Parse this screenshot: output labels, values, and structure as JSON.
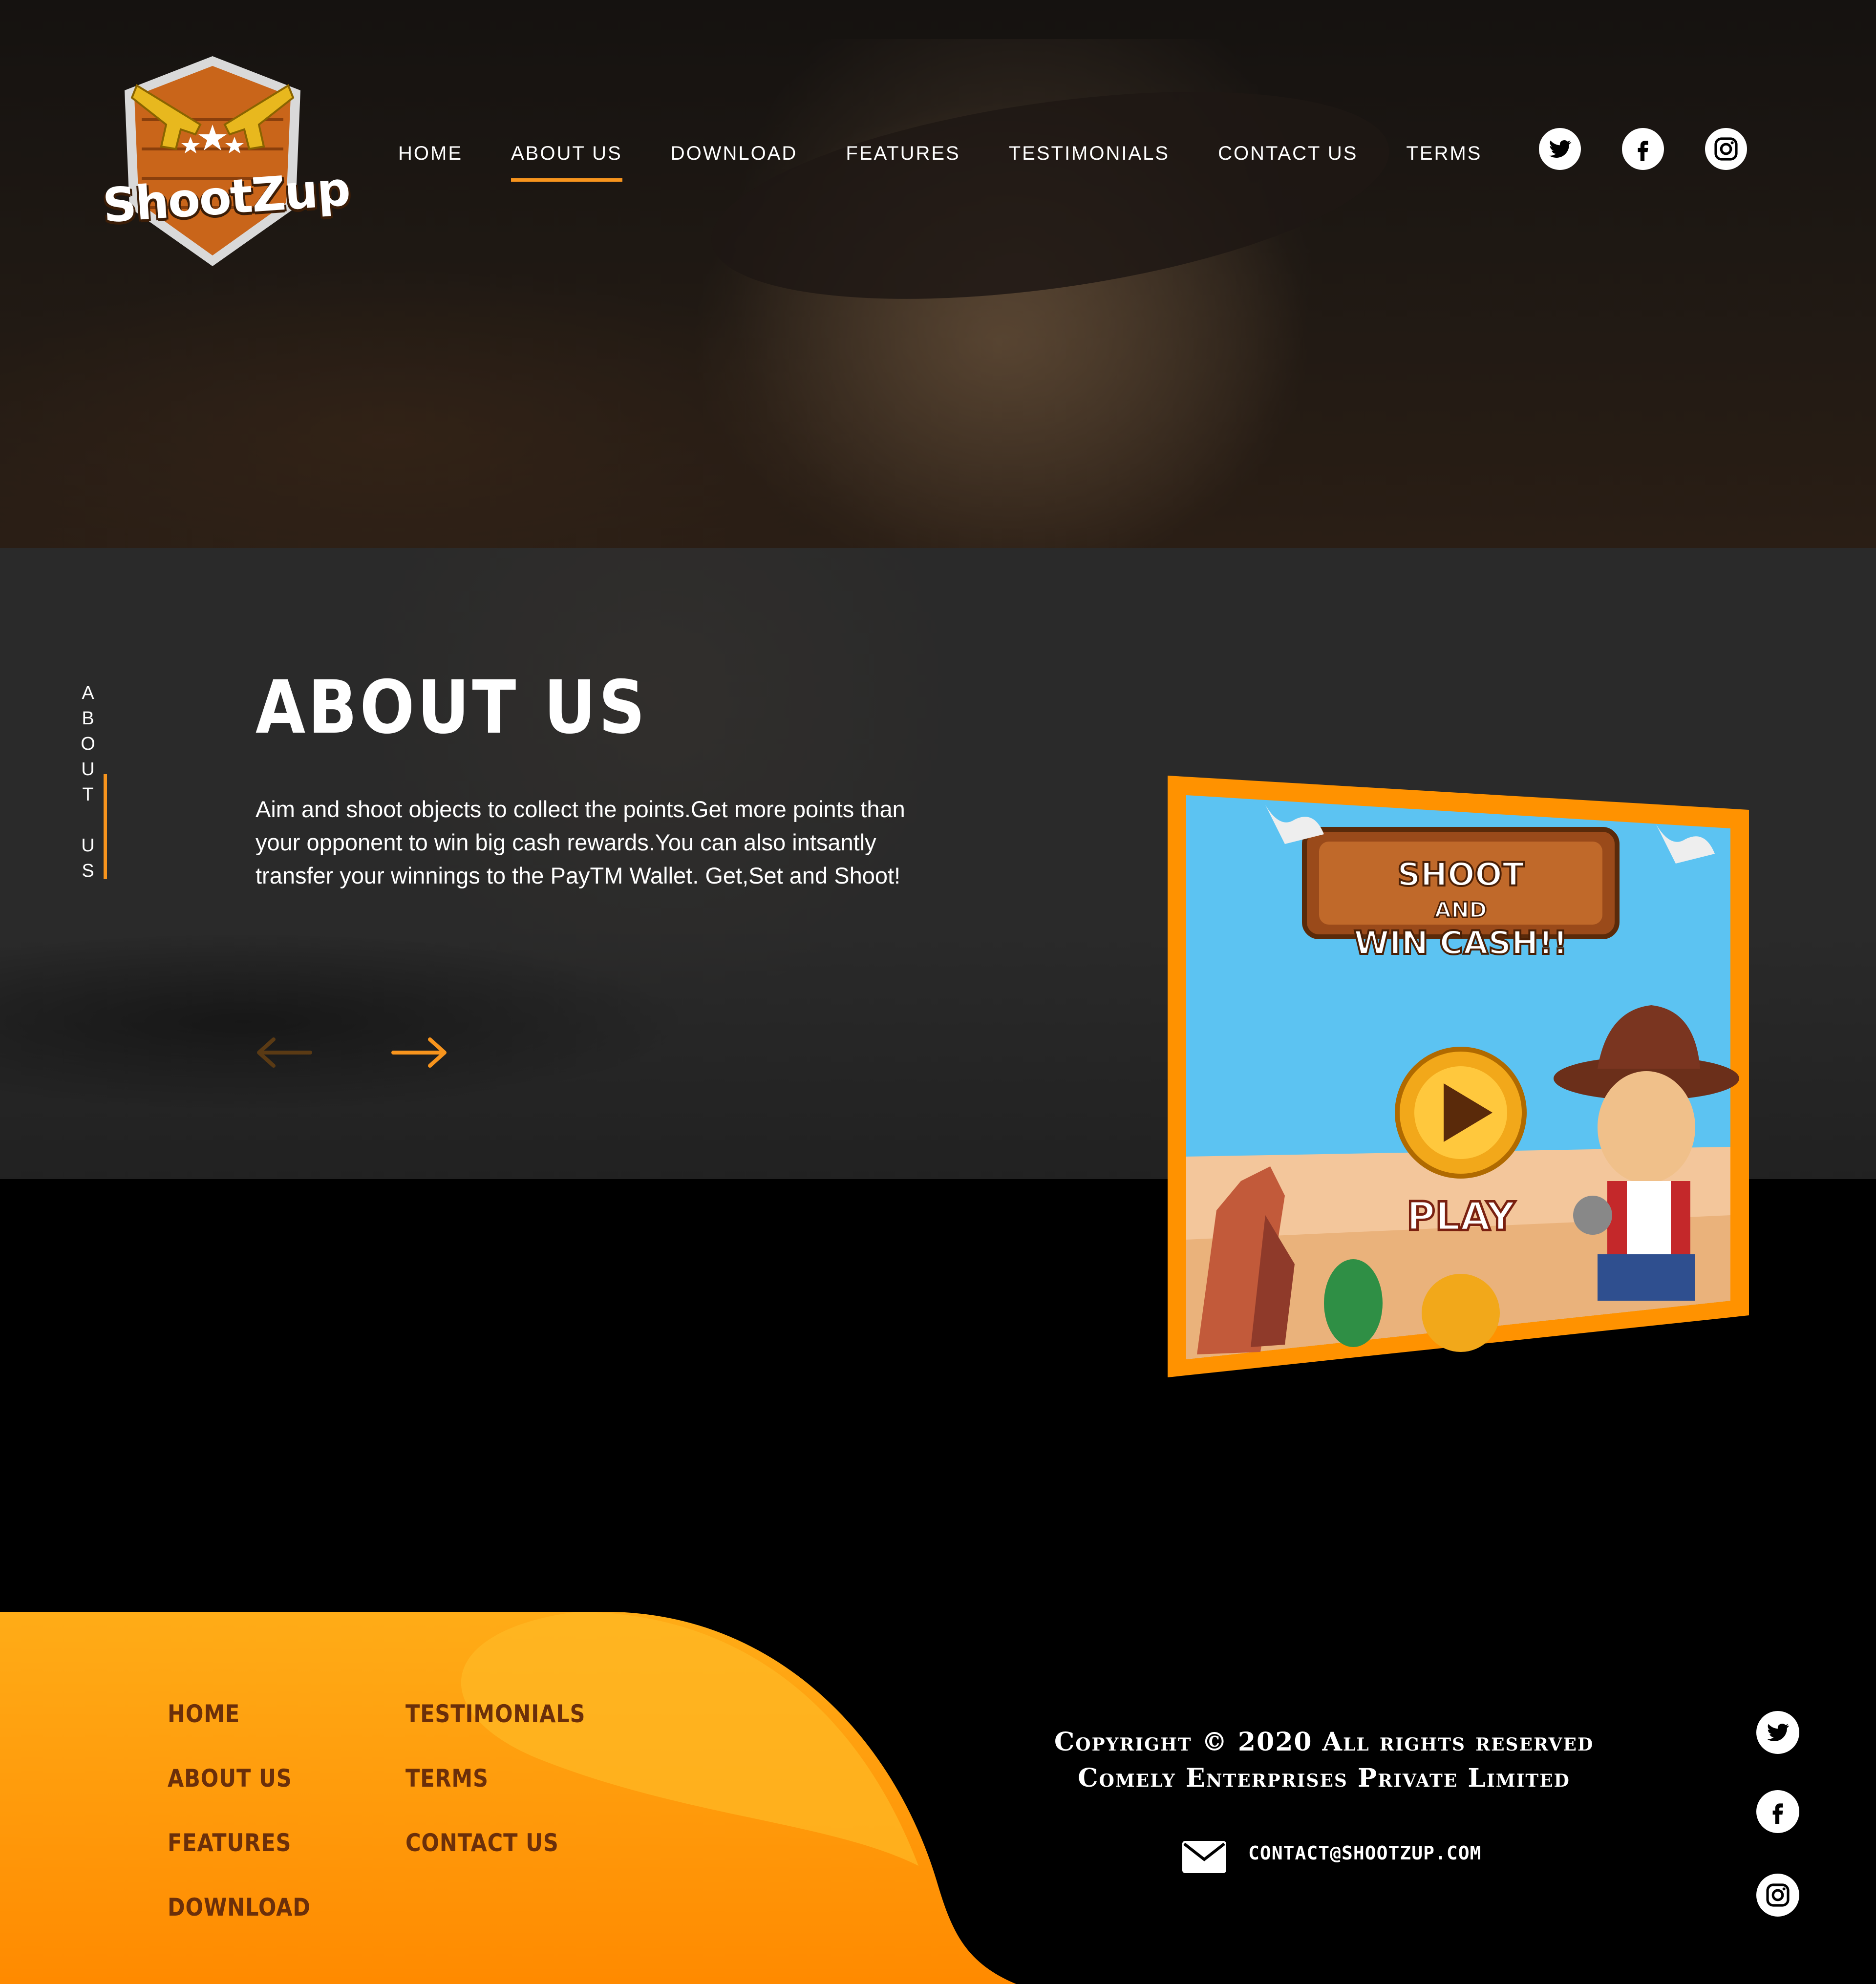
{
  "brand": {
    "logo_text": "ShootZup"
  },
  "nav": {
    "items": [
      "HOME",
      "ABOUT US",
      "DOWNLOAD",
      "FEATURES",
      "TESTIMONIALS",
      "CONTACT US",
      "TERMS"
    ],
    "active": "ABOUT US"
  },
  "social": [
    "twitter-icon",
    "facebook-icon",
    "instagram-icon"
  ],
  "about": {
    "vertical_label": [
      "A",
      "B",
      "O",
      "U",
      "T",
      "",
      "U",
      "S"
    ],
    "title": "ABOUT US",
    "body": "Aim and shoot objects to collect the points.Get more points than your opponent to win big cash rewards.You can also intsantly transfer your winnings to the PayTM Wallet. Get,Set and Shoot!"
  },
  "game_screen": {
    "banner_line1": "SHOOT",
    "banner_line2": "AND",
    "banner_line3": "WIN CASH!!",
    "play_label": "PLAY"
  },
  "footer": {
    "links_col1": [
      "HOME",
      "ABOUT US",
      "FEATURES",
      "DOWNLOAD"
    ],
    "links_col2": [
      "TESTIMONIALS",
      "TERMS",
      "CONTACT US"
    ],
    "copyright_line1": "Copyright © 2020 All rights reserved",
    "copyright_line2": "Comely Enterprises Private Limited",
    "email": "contact@shootzup.com"
  },
  "colors": {
    "accent": "#f7941d",
    "footer_orange": "#ff8c00",
    "footer_link": "#6b2f0a"
  }
}
